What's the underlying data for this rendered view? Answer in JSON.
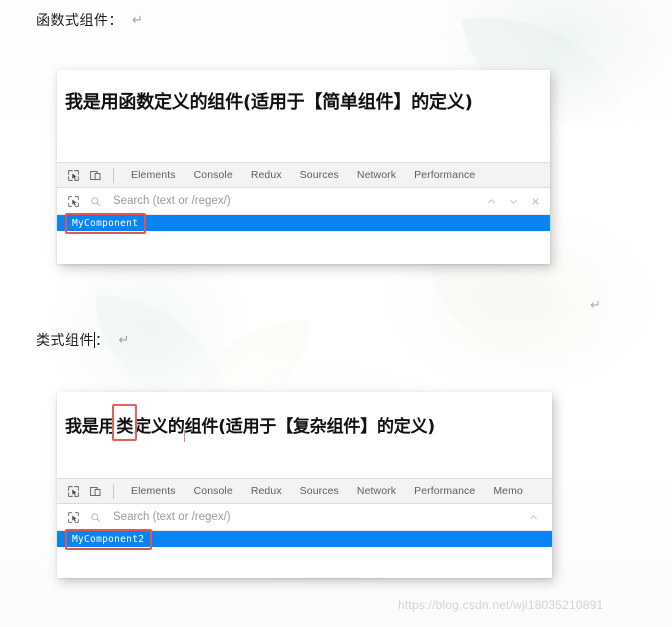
{
  "document": {
    "section_1_label": "函数式组件：",
    "section_2_label": "类式组件",
    "section_2_label_suffix": "：",
    "pilcrow": "↵"
  },
  "panel_1": {
    "page_heading": "我是用函数定义的组件(适用于【简单组件】的定义)",
    "devtools": {
      "inspect_icon": "inspect-element-icon",
      "device_icon": "device-toolbar-icon",
      "tabs": [
        {
          "label": "Elements"
        },
        {
          "label": "Console"
        },
        {
          "label": "Redux"
        },
        {
          "label": "Sources"
        },
        {
          "label": "Network"
        },
        {
          "label": "Performance"
        }
      ],
      "search": {
        "select_icon": "select-node-icon",
        "search_icon": "search-icon",
        "placeholder": "Search (text or /regex/)",
        "prev_icon": "chevron-up-icon",
        "next_icon": "chevron-down-icon",
        "close_icon": "close-icon"
      },
      "selected_node": "MyComponent"
    }
  },
  "panel_2": {
    "page_heading_pre": "我是用",
    "page_heading_boxed": "类",
    "page_heading_post": "定义的组件(适用于【复杂组件】的定义)",
    "devtools": {
      "inspect_icon": "inspect-element-icon",
      "device_icon": "device-toolbar-icon",
      "tabs": [
        {
          "label": "Elements"
        },
        {
          "label": "Console"
        },
        {
          "label": "Redux"
        },
        {
          "label": "Sources"
        },
        {
          "label": "Network"
        },
        {
          "label": "Performance"
        },
        {
          "label": "Memo"
        }
      ],
      "search": {
        "select_icon": "select-node-icon",
        "search_icon": "search-icon",
        "placeholder": "Search (text or /regex/)",
        "prev_icon": "chevron-up-icon"
      },
      "selected_node": "MyComponent2"
    }
  },
  "watermark": {
    "url": "https://blog.csdn.net/wjl18035210891"
  },
  "colors": {
    "selection_blue": "#0b84f3",
    "annotation_red": "#e2564c",
    "toolbar_gray": "#f3f3f3",
    "tab_text": "#5d5d5d",
    "placeholder_text": "#9a9a9a",
    "watermark_text": "#d3d3d3"
  }
}
